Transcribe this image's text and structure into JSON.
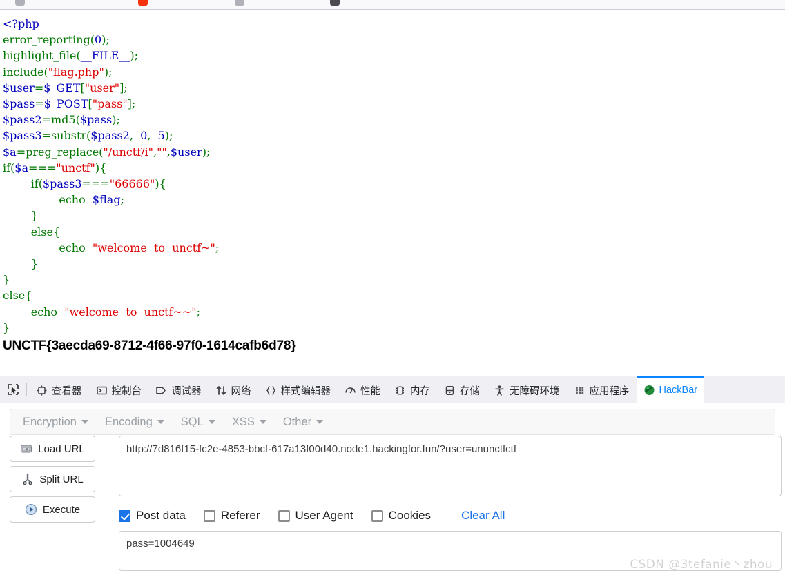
{
  "browser": {
    "bookmark_favicons": [
      "#b0b0b8",
      "#f4320c",
      "#b0b0b8",
      "#4b4b52"
    ]
  },
  "page": {
    "php_lines": [
      [
        {
          "t": "<?php",
          "c": "var"
        }
      ],
      [
        {
          "t": "error_reporting",
          "c": "kw"
        },
        {
          "t": "(",
          "c": "kw"
        },
        {
          "t": "0",
          "c": "num"
        },
        {
          "t": ");",
          "c": "kw"
        }
      ],
      [
        {
          "t": "highlight_file",
          "c": "kw"
        },
        {
          "t": "(",
          "c": "kw"
        },
        {
          "t": "__FILE__",
          "c": "var"
        },
        {
          "t": ");",
          "c": "kw"
        }
      ],
      [
        {
          "t": "include",
          "c": "kw"
        },
        {
          "t": "(",
          "c": "kw"
        },
        {
          "t": "\"flag.php\"",
          "c": "str"
        },
        {
          "t": ");",
          "c": "kw"
        }
      ],
      [
        {
          "t": "$user",
          "c": "var"
        },
        {
          "t": "=",
          "c": "kw"
        },
        {
          "t": "$_GET",
          "c": "var"
        },
        {
          "t": "[",
          "c": "kw"
        },
        {
          "t": "\"user\"",
          "c": "str"
        },
        {
          "t": "];",
          "c": "kw"
        }
      ],
      [
        {
          "t": "$pass",
          "c": "var"
        },
        {
          "t": "=",
          "c": "kw"
        },
        {
          "t": "$_POST",
          "c": "var"
        },
        {
          "t": "[",
          "c": "kw"
        },
        {
          "t": "\"pass\"",
          "c": "str"
        },
        {
          "t": "];",
          "c": "kw"
        }
      ],
      [
        {
          "t": "$pass2",
          "c": "var"
        },
        {
          "t": "=",
          "c": "kw"
        },
        {
          "t": "md5",
          "c": "kw"
        },
        {
          "t": "(",
          "c": "kw"
        },
        {
          "t": "$pass",
          "c": "var"
        },
        {
          "t": ");",
          "c": "kw"
        }
      ],
      [
        {
          "t": "$pass3",
          "c": "var"
        },
        {
          "t": "=",
          "c": "kw"
        },
        {
          "t": "substr",
          "c": "kw"
        },
        {
          "t": "(",
          "c": "kw"
        },
        {
          "t": "$pass2",
          "c": "var"
        },
        {
          "t": ",  ",
          "c": "kw"
        },
        {
          "t": "0",
          "c": "num"
        },
        {
          "t": ",  ",
          "c": "kw"
        },
        {
          "t": "5",
          "c": "num"
        },
        {
          "t": ");",
          "c": "kw"
        }
      ],
      [
        {
          "t": "$a",
          "c": "var"
        },
        {
          "t": "=",
          "c": "kw"
        },
        {
          "t": "preg_replace",
          "c": "kw"
        },
        {
          "t": "(",
          "c": "kw"
        },
        {
          "t": "\"/unctf/i\"",
          "c": "str"
        },
        {
          "t": ",",
          "c": "kw"
        },
        {
          "t": "\"\"",
          "c": "str"
        },
        {
          "t": ",",
          "c": "kw"
        },
        {
          "t": "$user",
          "c": "var"
        },
        {
          "t": ");",
          "c": "kw"
        }
      ],
      [
        {
          "t": "if",
          "c": "kw"
        },
        {
          "t": "(",
          "c": "kw"
        },
        {
          "t": "$a",
          "c": "var"
        },
        {
          "t": "===",
          "c": "kw"
        },
        {
          "t": "\"unctf\"",
          "c": "str"
        },
        {
          "t": "){",
          "c": "kw"
        }
      ],
      [
        {
          "t": "        if",
          "c": "kw"
        },
        {
          "t": "(",
          "c": "kw"
        },
        {
          "t": "$pass3",
          "c": "var"
        },
        {
          "t": "===",
          "c": "kw"
        },
        {
          "t": "\"66666\"",
          "c": "str"
        },
        {
          "t": "){",
          "c": "kw"
        }
      ],
      [
        {
          "t": "                echo  ",
          "c": "kw"
        },
        {
          "t": "$flag",
          "c": "var"
        },
        {
          "t": ";",
          "c": "kw"
        }
      ],
      [
        {
          "t": "        }",
          "c": "kw"
        }
      ],
      [
        {
          "t": "        else{",
          "c": "kw"
        }
      ],
      [
        {
          "t": "                echo  ",
          "c": "kw"
        },
        {
          "t": "\"welcome  to  unctf~\"",
          "c": "str"
        },
        {
          "t": ";",
          "c": "kw"
        }
      ],
      [
        {
          "t": "        }",
          "c": "kw"
        }
      ],
      [
        {
          "t": "}",
          "c": "kw"
        }
      ],
      [
        {
          "t": "else{",
          "c": "kw"
        }
      ],
      [
        {
          "t": "        echo  ",
          "c": "kw"
        },
        {
          "t": "\"welcome  to  unctf~~\"",
          "c": "str"
        },
        {
          "t": ";",
          "c": "kw"
        }
      ],
      [
        {
          "t": "}",
          "c": "kw"
        }
      ]
    ],
    "flag": "UNCTF{3aecda69-8712-4f66-97f0-1614cafb6d78}"
  },
  "devtools": {
    "picker_icon": "element-picker-icon",
    "tabs": [
      {
        "label": "查看器",
        "icon": "inspector-icon",
        "active": false
      },
      {
        "label": "控制台",
        "icon": "console-icon",
        "active": false
      },
      {
        "label": "调试器",
        "icon": "debugger-icon",
        "active": false
      },
      {
        "label": "网络",
        "icon": "network-icon",
        "active": false
      },
      {
        "label": "样式编辑器",
        "icon": "style-editor-icon",
        "active": false
      },
      {
        "label": "性能",
        "icon": "performance-icon",
        "active": false
      },
      {
        "label": "内存",
        "icon": "memory-icon",
        "active": false
      },
      {
        "label": "存储",
        "icon": "storage-icon",
        "active": false
      },
      {
        "label": "无障碍环境",
        "icon": "accessibility-icon",
        "active": false
      },
      {
        "label": "应用程序",
        "icon": "application-icon",
        "active": false
      },
      {
        "label": "HackBar",
        "icon": "hackbar-icon",
        "active": true
      }
    ],
    "active_tab_color": "#0a84ff"
  },
  "hackbar": {
    "menus": [
      {
        "label": "Encryption"
      },
      {
        "label": "Encoding"
      },
      {
        "label": "SQL"
      },
      {
        "label": "XSS"
      },
      {
        "label": "Other"
      }
    ],
    "buttons": [
      {
        "label": "Load URL",
        "icon": "load-url-icon"
      },
      {
        "label": "Split URL",
        "icon": "split-url-scissors-icon"
      },
      {
        "label": "Execute",
        "icon": "execute-play-icon"
      }
    ],
    "url": {
      "value": "http://7d816f15-fc2e-4853-bbcf-617a13f00d40.node1.hackingfor.fun/?user=ununctfctf",
      "placeholder": "URL"
    },
    "options": [
      {
        "label": "Post data",
        "checked": true
      },
      {
        "label": "Referer",
        "checked": false
      },
      {
        "label": "User Agent",
        "checked": false
      },
      {
        "label": "Cookies",
        "checked": false
      }
    ],
    "clear_all_label": "Clear All",
    "post_data": {
      "value": "pass=1004649",
      "placeholder": "Post data"
    },
    "accent_color": "#1a73e8"
  },
  "watermark": "CSDN @3tefanie丶zhou"
}
